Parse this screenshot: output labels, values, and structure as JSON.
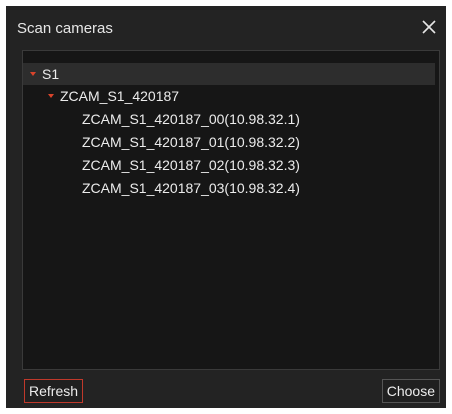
{
  "dialog": {
    "title": "Scan cameras",
    "close_icon": "close-icon"
  },
  "tree": {
    "root": {
      "label": "S1",
      "expanded": true,
      "selected": true,
      "children": [
        {
          "label": "ZCAM_S1_420187",
          "expanded": true,
          "children": [
            {
              "label": "ZCAM_S1_420187_00(10.98.32.1)"
            },
            {
              "label": "ZCAM_S1_420187_01(10.98.32.2)"
            },
            {
              "label": "ZCAM_S1_420187_02(10.98.32.3)"
            },
            {
              "label": "ZCAM_S1_420187_03(10.98.32.4)"
            }
          ]
        }
      ]
    }
  },
  "footer": {
    "refresh_label": "Refresh",
    "choose_label": "Choose"
  },
  "colors": {
    "dialog_bg": "#232323",
    "panel_bg": "#161616",
    "accent": "#d9442b",
    "refresh_border": "#c0392b"
  }
}
